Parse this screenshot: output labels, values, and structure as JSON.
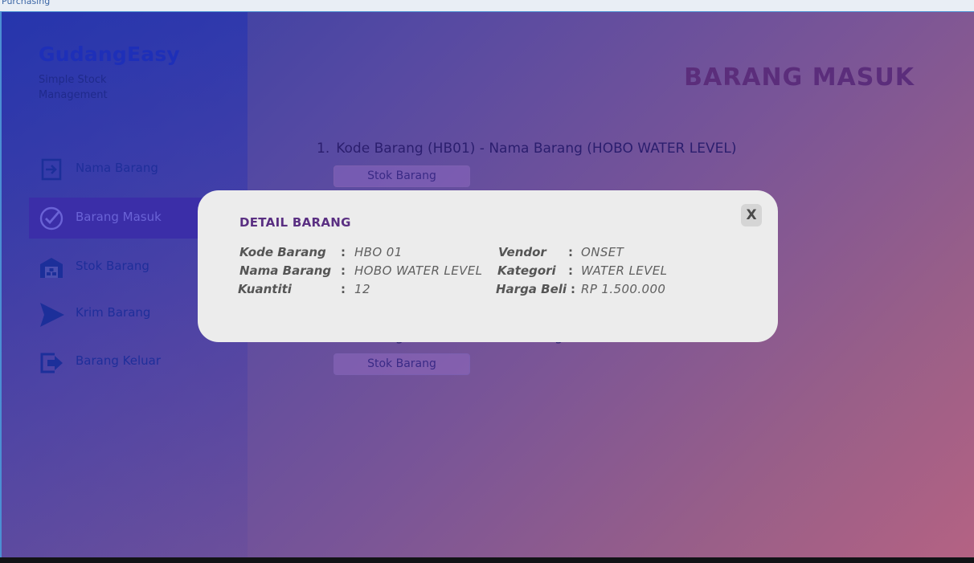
{
  "window": {
    "title": "Purchasing"
  },
  "app": {
    "brand": "GudangEasy",
    "tagline": "Simple Stock Management"
  },
  "sidebar": {
    "items": [
      {
        "label": "Nama Barang",
        "icon": "enter-icon",
        "active": false
      },
      {
        "label": "Barang Masuk",
        "icon": "check-circle-icon",
        "active": true
      },
      {
        "label": "Stok Barang",
        "icon": "warehouse-icon",
        "active": false
      },
      {
        "label": "Krim Barang",
        "icon": "send-icon",
        "active": false
      },
      {
        "label": "Barang Keluar",
        "icon": "exit-icon",
        "active": false
      }
    ]
  },
  "page": {
    "title": "BARANG MASUK"
  },
  "items": [
    {
      "number": "1.",
      "text": "Kode Barang (HB01) - Nama Barang (HOBO WATER LEVEL)",
      "button": "Stok Barang"
    },
    {
      "button": "Stok Barang"
    }
  ],
  "modal": {
    "title": "DETAIL BARANG",
    "close": "X",
    "separator": ":",
    "fields": {
      "kode_label": "Kode Barang",
      "kode_value": "HBO 01",
      "nama_label": "Nama Barang",
      "nama_value": "HOBO WATER LEVEL",
      "kuantiti_label": "Kuantiti",
      "kuantiti_value": "12",
      "vendor_label": "Vendor",
      "vendor_value": "ONSET",
      "kategori_label": "Kategori",
      "kategori_value": "WATER LEVEL",
      "harga_label": "Harga Beli",
      "harga_value": "RP 1.500.000"
    }
  },
  "colors": {
    "accent": "#5a2f82",
    "sidebar_active": "#3b2ea8",
    "brand": "#1e2fb8"
  }
}
